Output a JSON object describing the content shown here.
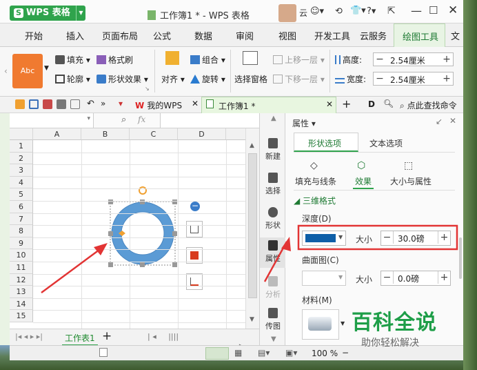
{
  "app": {
    "logo": "WPS 表格",
    "logo_letter": "S",
    "doc_title": "工作簿1 * - WPS 表格",
    "user": "云"
  },
  "tabs": [
    "开始",
    "插入",
    "页面布局",
    "公式",
    "数据",
    "审阅",
    "视图",
    "开发工具",
    "云服务",
    "绘图工具",
    "文"
  ],
  "ribbon": {
    "style_preview": "Abc",
    "fill": "填充",
    "format_brush": "格式刷",
    "outline": "轮廓",
    "shape_effect": "形状效果",
    "align": "对齐",
    "combine": "组合",
    "rotate": "旋转",
    "select_pane": "选择窗格",
    "bring_up": "上移一层",
    "send_down": "下移一层",
    "height_label": "高度:",
    "height_value": "2.54厘米",
    "width_label": "宽度:",
    "width_value": "2.54厘米"
  },
  "quickbar": {
    "my_wps": "我的WPS",
    "doc_tab": "工作簿1 *",
    "find_cmd": "点此查找命令"
  },
  "formula_bar": {
    "fx": "fx"
  },
  "grid": {
    "columns": [
      "A",
      "B",
      "C",
      "D"
    ],
    "rows": [
      "1",
      "2",
      "3",
      "4",
      "5",
      "6",
      "7",
      "8",
      "9",
      "10",
      "11",
      "12",
      "13",
      "14",
      "15"
    ]
  },
  "sheet": {
    "name": "工作表1",
    "add": "+"
  },
  "sidebar": [
    "新建",
    "选择",
    "形状",
    "属性",
    "分析",
    "传图"
  ],
  "panel": {
    "title": "属性",
    "tabs": [
      "形状选项",
      "文本选项"
    ],
    "subtabs": [
      "填充与线条",
      "效果",
      "大小与属性"
    ],
    "section": "三维格式",
    "depth_label": "深度(D)",
    "depth_color": "#0e5fa8",
    "size_label": "大小",
    "depth_value": "30.0磅",
    "contour_label": "曲面图(C)",
    "contour_value": "0.0磅",
    "material_label": "材料(M)"
  },
  "watermark": {
    "title": "百科全说",
    "subtitle": "助你轻松解决"
  },
  "status": {
    "zoom": "100 %"
  },
  "colors": {
    "ring": "#5b9bd5",
    "accent": "#2fa34c",
    "arrow": "#e23434"
  }
}
